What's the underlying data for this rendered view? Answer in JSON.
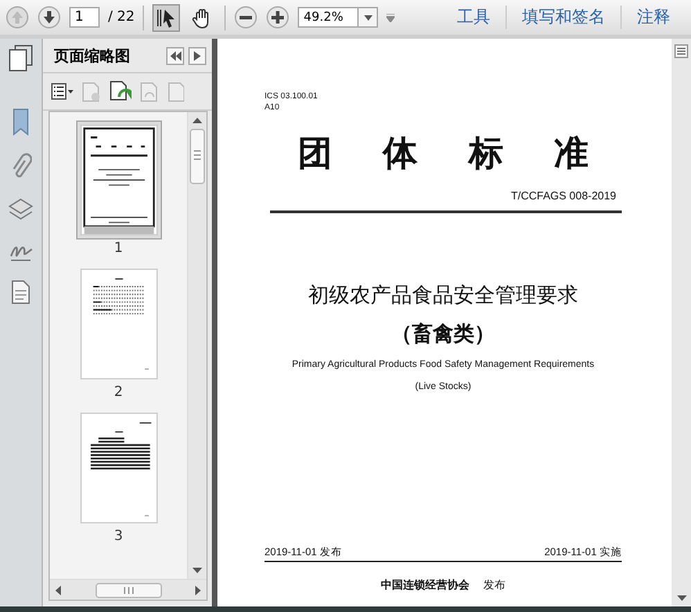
{
  "toolbar": {
    "page_field": {
      "value": "1"
    },
    "page_total": "/ 22",
    "zoom_field": {
      "value": "49.2%"
    },
    "select_tool": {
      "selected": true
    },
    "hand_tool": {
      "selected": false
    },
    "menu": [
      {
        "label": "工具"
      },
      {
        "label": "填写和签名"
      },
      {
        "label": "注释"
      }
    ]
  },
  "thumbnail_panel": {
    "title": "页面缩略图",
    "thumbnails": [
      {
        "label": "1",
        "kind": "cover",
        "selected": true
      },
      {
        "label": "2",
        "kind": "contents",
        "selected": false
      },
      {
        "label": "3",
        "kind": "text",
        "selected": false
      }
    ]
  },
  "document": {
    "ics": "ICS 03.100.01",
    "class_code": "A10",
    "heading": "团 体 标 准",
    "standard_number": "T/CCFAGS 008-2019",
    "title": "初级农产品食品安全管理要求",
    "subtitle": "（畜禽类）",
    "english_title": "Primary Agricultural Products Food Safety Management Requirements",
    "english_subtitle": "(Live Stocks)",
    "issue_date": "2019-11-01 发布",
    "effective_date": "2019-11-01 实施",
    "publisher": "中国连锁经营协会",
    "publisher_suffix": "发布"
  }
}
